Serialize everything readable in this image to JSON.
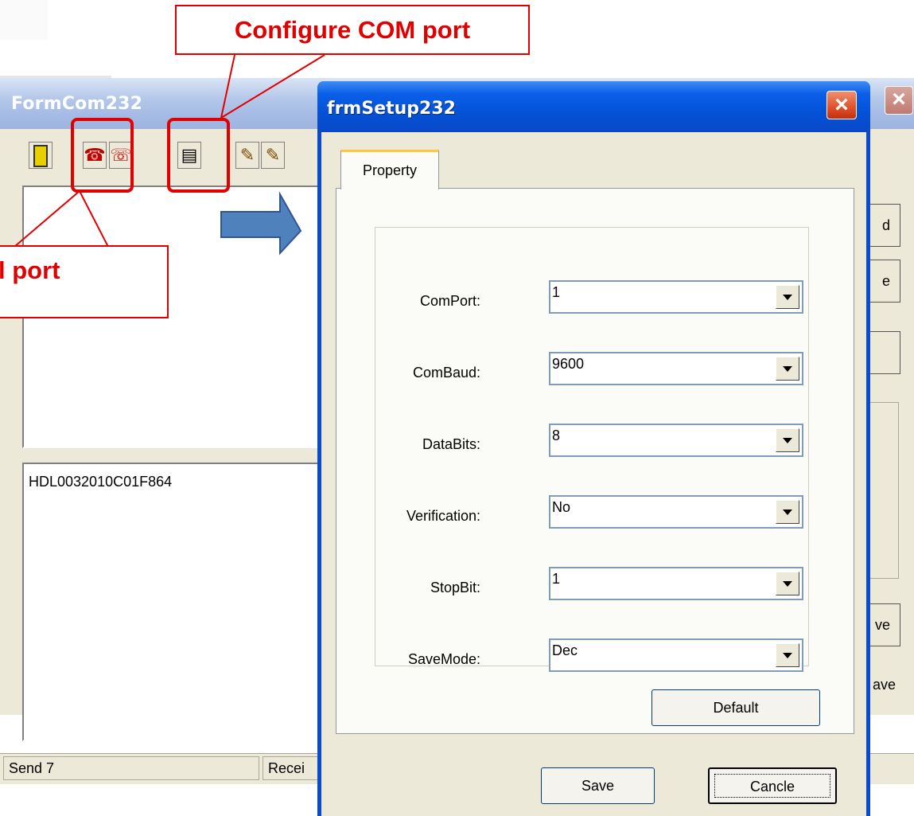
{
  "annotations": {
    "configure_com_port": "Configure COM port",
    "open_port": "l port"
  },
  "back_window": {
    "title": "FormCom232",
    "send_text": "HDL0032010C01F864",
    "status_send": "Send 7",
    "status_receive": "Recei",
    "side_button_1": "d",
    "side_button_2": "e",
    "side_button_3": "",
    "side_button_4": "ve",
    "side_checkbox": "ave",
    "toolbar_icons": [
      "exit-icon",
      "phone-open-icon",
      "phone-close-icon",
      "setup-icon",
      "clear-send-icon",
      "clear-receive-icon"
    ]
  },
  "dialog": {
    "title": "frmSetup232",
    "tab": "Property",
    "fields": {
      "comport": {
        "label": "ComPort:",
        "value": "1"
      },
      "combaud": {
        "label": "ComBaud:",
        "value": "9600"
      },
      "databits": {
        "label": "DataBits:",
        "value": "8"
      },
      "verification": {
        "label": "Verification:",
        "value": "No"
      },
      "stopbit": {
        "label": "StopBit:",
        "value": "1"
      },
      "savemode": {
        "label": "SaveMode:",
        "value": "Dec"
      }
    },
    "buttons": {
      "default": "Default",
      "save": "Save",
      "cancle": "Cancle"
    }
  },
  "colors": {
    "annotation_red": "#e00000",
    "arrow_blue": "#4f81bd",
    "dialog_title_blue": "#0a5fe8"
  }
}
